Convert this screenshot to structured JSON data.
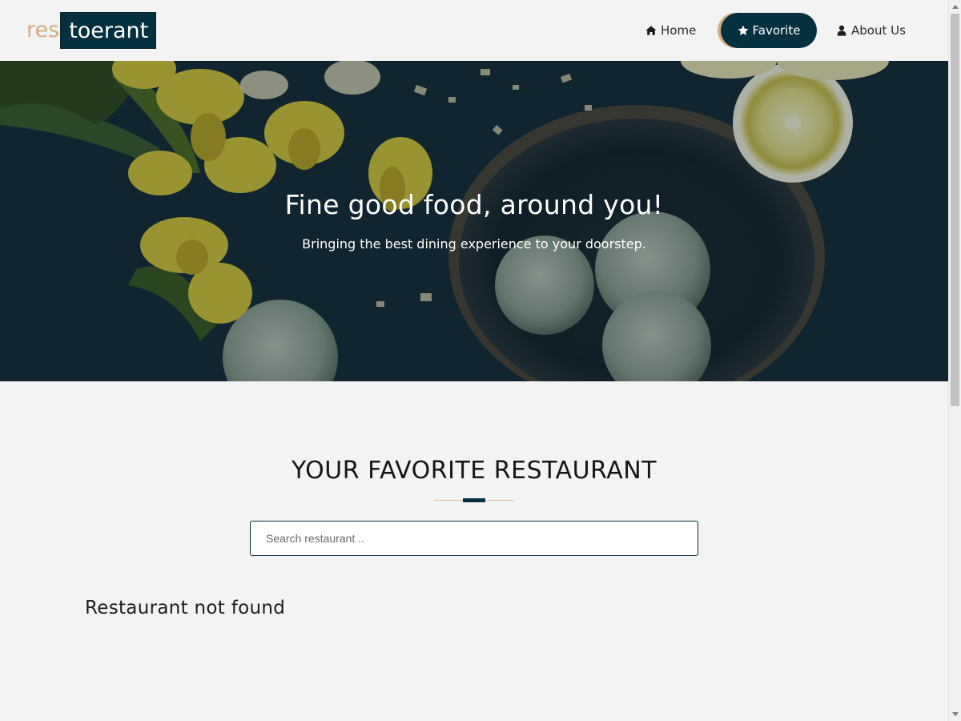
{
  "brand": {
    "logo_part_1": "res",
    "logo_part_2": "toerant",
    "accent_color": "#d3ad84",
    "primary_color": "#04303f"
  },
  "nav": {
    "items": [
      {
        "label": "Home",
        "icon": "home-icon",
        "active": false
      },
      {
        "label": "Favorite",
        "icon": "star-icon",
        "active": true
      },
      {
        "label": "About Us",
        "icon": "user-icon",
        "active": false
      }
    ]
  },
  "hero": {
    "title": "Fine good food, around you!",
    "subtitle": "Bringing the best dining experience to your doorstep."
  },
  "main": {
    "section_title": "YOUR FAVORITE RESTAURANT",
    "search": {
      "value": "",
      "placeholder": "Search restaurant .."
    },
    "empty_message": "Restaurant not found"
  }
}
